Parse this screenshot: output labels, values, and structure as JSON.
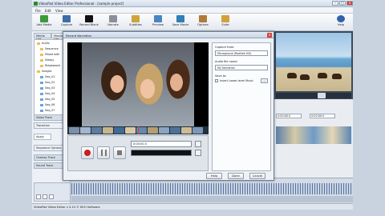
{
  "app": {
    "title": "VideoPad Video Editor Professional - [sample project]",
    "menu": [
      "File",
      "Edit",
      "View"
    ],
    "help_label": "Help",
    "toolbar": [
      "Add Media",
      "Capture",
      "Record Blank",
      "Narrate",
      "Subtitles",
      "Preview",
      "Save Movie",
      "Options",
      "Suite"
    ],
    "status": "VideoPad Video Editor v 4.10 © NCH Software"
  },
  "left_panel": {
    "tabs": [
      "Media List",
      "Media List"
    ],
    "tree": [
      "Audio",
      "Sequence",
      "Mixed with",
      "Sleepy",
      "Ridgewood",
      "Images",
      "Seq_01",
      "Seq_02",
      "Seq_03",
      "Seq_04",
      "Seq_05",
      "Seq_06",
      "Seq_07"
    ],
    "sections": [
      "Video Track",
      "Transition",
      "Apply",
      "Sequence Options",
      "Overlay Track",
      "Sound Track"
    ]
  },
  "dialog": {
    "title": "Record Narration",
    "close": "×",
    "time": "0:00:00.0",
    "capture_from_label": "Capture from:",
    "capture_from_value": "Microphone (Realtek HD)",
    "audio_file_label": "Audio file name:",
    "audio_file_value": "My Narration",
    "save_to_label": "Save to:",
    "save_to_option": "Insert Lower-level Music",
    "browse_label": "...",
    "buttons": {
      "help": "Help",
      "done": "Done",
      "cancel": "Cancel"
    }
  },
  "preview": {
    "time_left": "0:00:00.0",
    "time_right": "0:00:00.0"
  },
  "colors": {
    "record": "#c4201c",
    "accent": "#3a6ea5"
  }
}
